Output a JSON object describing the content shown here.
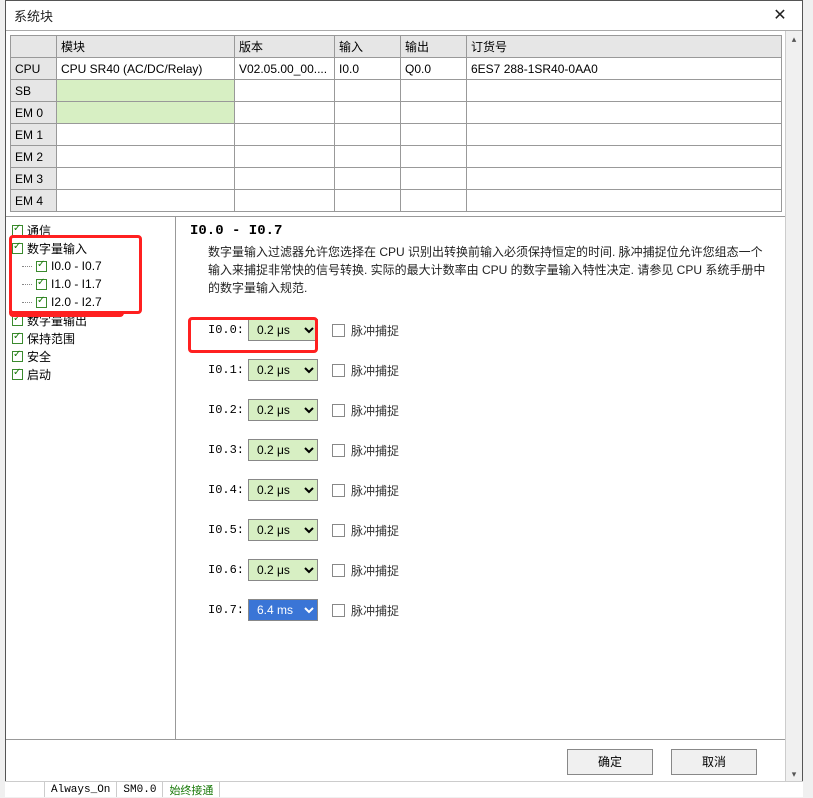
{
  "title": "系统块",
  "table": {
    "headers": [
      "",
      "模块",
      "版本",
      "输入",
      "输出",
      "订货号"
    ],
    "rows": [
      {
        "head": "CPU",
        "module": "CPU SR40 (AC/DC/Relay)",
        "version": "V02.05.00_00....",
        "input": "I0.0",
        "output": "Q0.0",
        "order": "6ES7 288-1SR40-0AA0",
        "green": false
      },
      {
        "head": "SB",
        "module": "",
        "version": "",
        "input": "",
        "output": "",
        "order": "",
        "green": true
      },
      {
        "head": "EM 0",
        "module": "",
        "version": "",
        "input": "",
        "output": "",
        "order": "",
        "green": true
      },
      {
        "head": "EM 1",
        "module": "",
        "version": "",
        "input": "",
        "output": "",
        "order": "",
        "green": false
      },
      {
        "head": "EM 2",
        "module": "",
        "version": "",
        "input": "",
        "output": "",
        "order": "",
        "green": false
      },
      {
        "head": "EM 3",
        "module": "",
        "version": "",
        "input": "",
        "output": "",
        "order": "",
        "green": false
      },
      {
        "head": "EM 4",
        "module": "",
        "version": "",
        "input": "",
        "output": "",
        "order": "",
        "green": false
      }
    ]
  },
  "tree": [
    {
      "label": "通信",
      "checked": true,
      "child": false
    },
    {
      "label": "数字量输入",
      "checked": true,
      "child": false
    },
    {
      "label": "I0.0 - I0.7",
      "checked": true,
      "child": true
    },
    {
      "label": "I1.0 - I1.7",
      "checked": true,
      "child": true
    },
    {
      "label": "I2.0 - I2.7",
      "checked": true,
      "child": true
    },
    {
      "label": "数字量输出",
      "checked": true,
      "child": false
    },
    {
      "label": "保持范围",
      "checked": true,
      "child": false
    },
    {
      "label": "安全",
      "checked": true,
      "child": false
    },
    {
      "label": "启动",
      "checked": true,
      "child": false
    }
  ],
  "detail": {
    "heading": "I0.0 - I0.7",
    "desc": "数字量输入过滤器允许您选择在 CPU 识别出转换前输入必须保持恒定的时间. 脉冲捕捉位允许您组态一个输入来捕捉非常快的信号转换. 实际的最大计数率由 CPU 的数字量输入特性决定. 请参见 CPU 系统手册中的数字量输入规范.",
    "pulse_label": "脉冲捕捉",
    "rows": [
      {
        "name": "I0.0:",
        "value": "0.2 μs",
        "highlight": false
      },
      {
        "name": "I0.1:",
        "value": "0.2 μs",
        "highlight": false
      },
      {
        "name": "I0.2:",
        "value": "0.2 μs",
        "highlight": false
      },
      {
        "name": "I0.3:",
        "value": "0.2 μs",
        "highlight": false
      },
      {
        "name": "I0.4:",
        "value": "0.2 μs",
        "highlight": false
      },
      {
        "name": "I0.5:",
        "value": "0.2 μs",
        "highlight": false
      },
      {
        "name": "I0.6:",
        "value": "0.2 μs",
        "highlight": false
      },
      {
        "name": "I0.7:",
        "value": "6.4 ms",
        "highlight": true
      }
    ]
  },
  "buttons": {
    "ok": "确定",
    "cancel": "取消"
  },
  "footer": {
    "a": "Always_On",
    "b": "SM0.0",
    "c": "始终接通"
  }
}
